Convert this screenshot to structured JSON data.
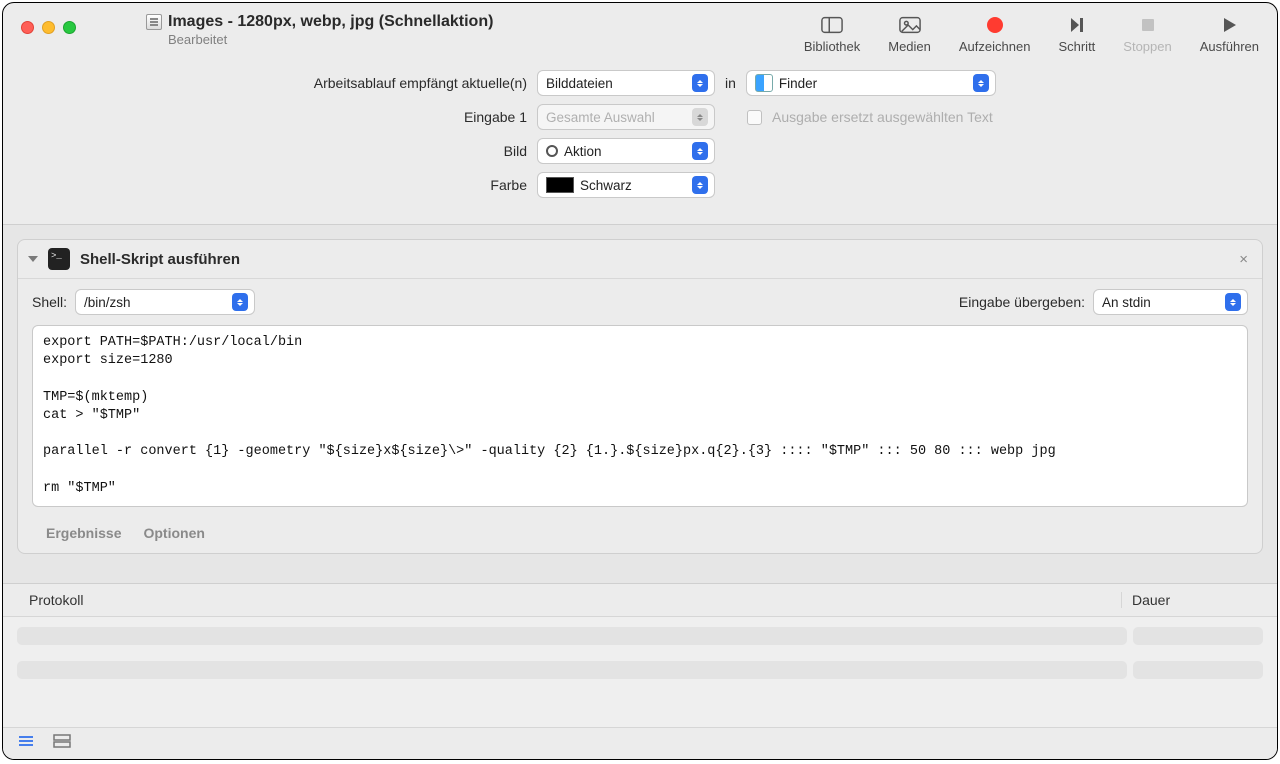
{
  "window": {
    "title": "Images - 1280px, webp, jpg (Schnellaktion)",
    "subtitle": "Bearbeitet"
  },
  "toolbar": {
    "library": "Bibliothek",
    "media": "Medien",
    "record": "Aufzeichnen",
    "step": "Schritt",
    "stop": "Stoppen",
    "run": "Ausführen"
  },
  "config": {
    "receives_label": "Arbeitsablauf empfängt aktuelle(n)",
    "receives_value": "Bilddateien",
    "in_label": "in",
    "in_value": "Finder",
    "input1_label": "Eingabe 1",
    "input1_value": "Gesamte Auswahl",
    "replace_checkbox_label": "Ausgabe ersetzt ausgewählten Text",
    "image_label": "Bild",
    "image_value": "Aktion",
    "color_label": "Farbe",
    "color_value": "Schwarz"
  },
  "action": {
    "title": "Shell-Skript ausführen",
    "shell_label": "Shell:",
    "shell_value": "/bin/zsh",
    "pass_label": "Eingabe übergeben:",
    "pass_value": "An stdin",
    "script": "export PATH=$PATH:/usr/local/bin\nexport size=1280\n\nTMP=$(mktemp)\ncat > \"$TMP\"\n\nparallel -r convert {1} -geometry \"${size}x${size}\\>\" -quality {2} {1.}.${size}px.q{2}.{3} :::: \"$TMP\" ::: 50 80 ::: webp jpg\n\nrm \"$TMP\"",
    "results": "Ergebnisse",
    "options": "Optionen"
  },
  "log": {
    "col_protocol": "Protokoll",
    "col_duration": "Dauer"
  }
}
